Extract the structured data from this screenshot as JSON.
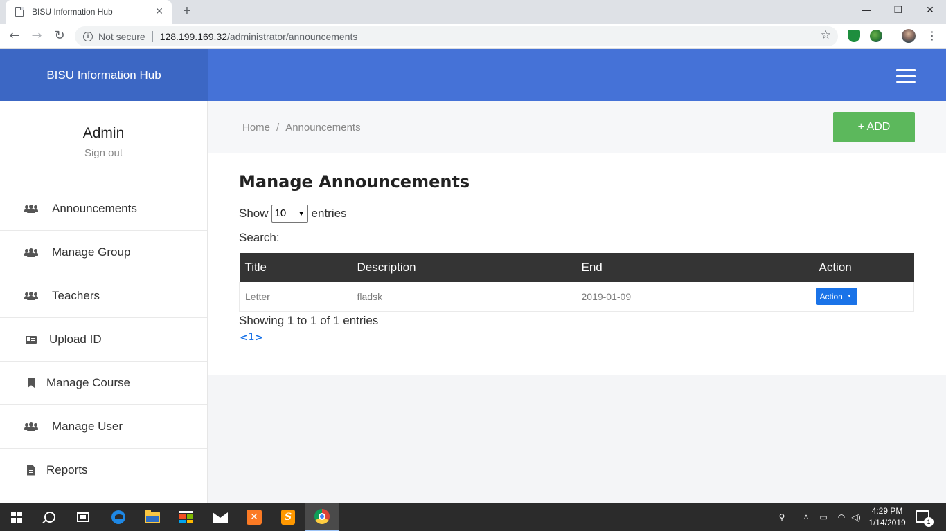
{
  "browser": {
    "tab_title": "BISU Information Hub",
    "tab_close": "✕",
    "new_tab": "+",
    "window_controls": {
      "minimize": "—",
      "restore": "❐",
      "close": "✕"
    },
    "nav": {
      "back": "←",
      "forward": "→",
      "reload": "↻"
    },
    "security_label": "Not secure",
    "url_host": "128.199.169.32",
    "url_path": "/administrator/announcements",
    "bookmark_star": "☆",
    "menu_dots": "⋮"
  },
  "app": {
    "brand": "BISU Information Hub",
    "accent_color": "#4572d7",
    "brand_bg_color": "#3c67c4"
  },
  "sidebar": {
    "user_name": "Admin",
    "sign_out": "Sign out",
    "items": [
      {
        "label": "Announcements",
        "icon": "users-icon"
      },
      {
        "label": "Manage Group",
        "icon": "users-icon"
      },
      {
        "label": "Teachers",
        "icon": "users-icon"
      },
      {
        "label": "Upload ID",
        "icon": "id-card-icon"
      },
      {
        "label": "Manage Course",
        "icon": "bookmark-icon"
      },
      {
        "label": "Manage User",
        "icon": "users-icon"
      },
      {
        "label": "Reports",
        "icon": "file-icon"
      }
    ]
  },
  "breadcrumb": {
    "home": "Home",
    "separator": "/",
    "current": "Announcements"
  },
  "add_button": {
    "label": "+ ADD",
    "color": "#5cb85c"
  },
  "main": {
    "title": "Manage Announcements",
    "show_prefix": "Show",
    "show_value": "10",
    "show_suffix": "entries",
    "search_label": "Search:",
    "table": {
      "columns": [
        "Title",
        "Description",
        "End",
        "Action"
      ],
      "rows": [
        {
          "title": "Letter",
          "description": "fladsk",
          "end": "2019-01-09",
          "action_label": "Action"
        }
      ]
    },
    "info": "Showing 1 to 1 of 1 entries",
    "pager": {
      "prev": "<",
      "page": "1",
      "next": ">"
    }
  },
  "taskbar": {
    "clock_time": "4:29 PM",
    "clock_date": "1/14/2019",
    "notification_count": "1"
  }
}
